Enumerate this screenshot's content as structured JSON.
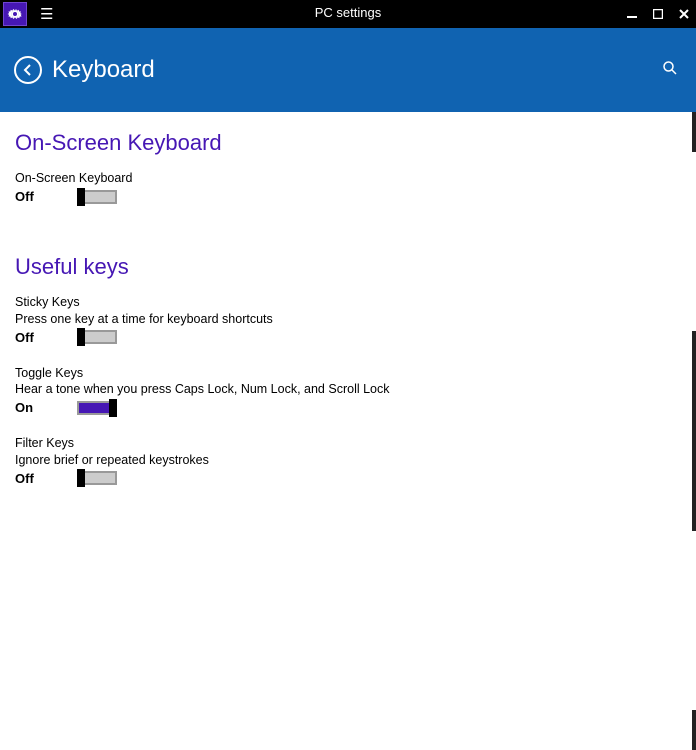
{
  "titlebar": {
    "app_title": "PC settings"
  },
  "header": {
    "page_title": "Keyboard"
  },
  "sections": {
    "onscreen": {
      "title": "On-Screen Keyboard",
      "item": {
        "label": "On-Screen Keyboard",
        "state": "Off",
        "on": false
      }
    },
    "useful": {
      "title": "Useful keys",
      "sticky": {
        "label": "Sticky Keys",
        "desc": "Press one key at a time for keyboard shortcuts",
        "state": "Off",
        "on": false
      },
      "toggle": {
        "label": "Toggle Keys",
        "desc": "Hear a tone when you press Caps Lock, Num Lock, and Scroll Lock",
        "state": "On",
        "on": true
      },
      "filter": {
        "label": "Filter Keys",
        "desc": "Ignore brief or repeated keystrokes",
        "state": "Off",
        "on": false
      }
    }
  }
}
